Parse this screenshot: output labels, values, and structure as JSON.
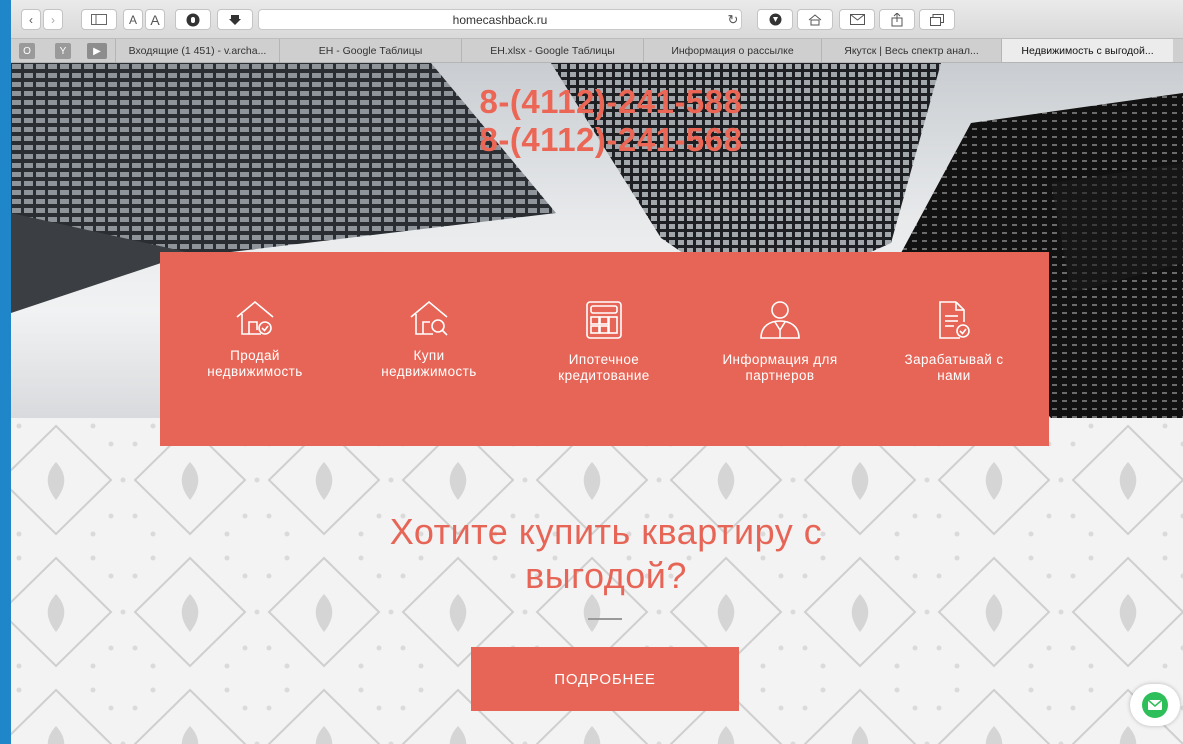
{
  "browser": {
    "url": "homecashback.ru",
    "reader_small": "A",
    "reader_large": "A",
    "favorites": [
      {
        "label": "О"
      },
      {
        "label": "Y"
      }
    ],
    "tabs": [
      {
        "label": "Входящие (1 451) - v.archa..."
      },
      {
        "label": "ЕН - Google Таблицы"
      },
      {
        "label": "ЕН.xlsx - Google Таблицы"
      },
      {
        "label": "Информация о рассылке"
      },
      {
        "label": "Якутск | Весь спектр анал..."
      },
      {
        "label": "Недвижимость с выгодой..."
      }
    ]
  },
  "hero": {
    "phone_1": "8-(4112)-241-588",
    "phone_2": "8-(4112)-241-568"
  },
  "services": [
    {
      "icon": "house-check-icon",
      "line1": "Продай",
      "line2": "недвижимость"
    },
    {
      "icon": "house-search-icon",
      "line1": "Купи",
      "line2": "недвижимость"
    },
    {
      "icon": "calculator-icon",
      "line1": "Ипотечное",
      "line2": "кредитование"
    },
    {
      "icon": "partner-person-icon",
      "line1": "Информация для",
      "line2": "партнеров"
    },
    {
      "icon": "document-check-icon",
      "line1": "Зарабатывай с",
      "line2": "нами"
    }
  ],
  "promo": {
    "headline_line1": "Хотите купить квартиру с",
    "headline_line2": "выгодой?",
    "button_label": "ПОДРОБНЕЕ"
  },
  "colors": {
    "accent": "#e76556",
    "chat": "#2fbf5a",
    "desktop": "#1f87c9"
  }
}
